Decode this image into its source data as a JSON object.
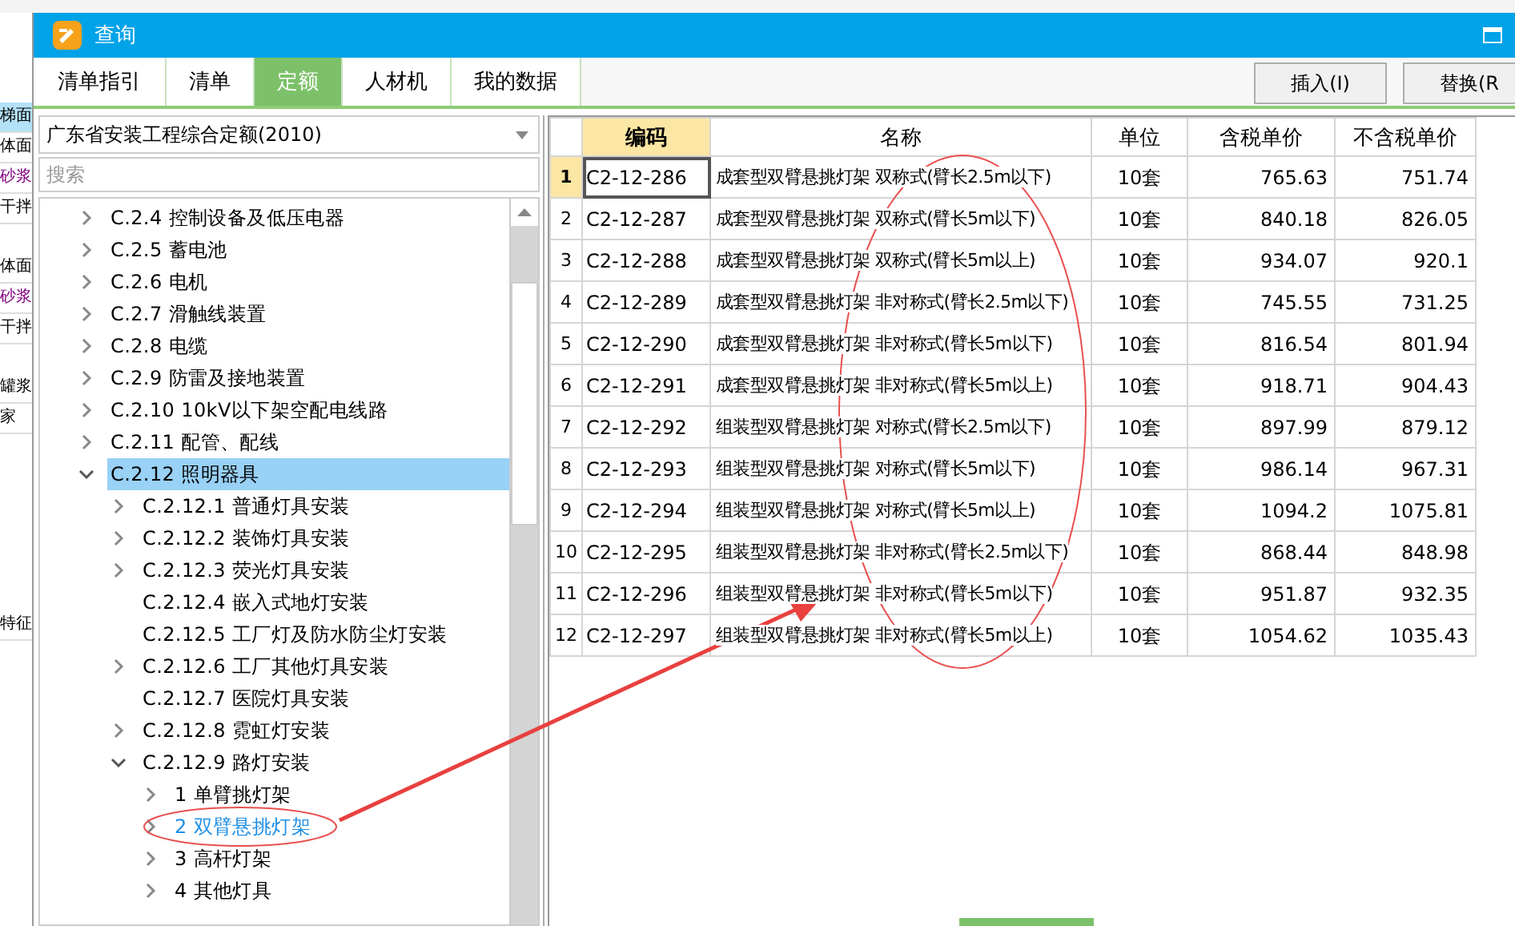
{
  "background_app": {
    "side_labels": [
      {
        "text": "梯面",
        "color": "#000000",
        "selected": true
      },
      {
        "text": "体面",
        "color": "#000000",
        "selected": false
      },
      {
        "text": "砂浆",
        "color": "#800080",
        "selected": false
      },
      {
        "text": "干拌",
        "color": "#000000",
        "selected": false
      },
      {
        "text": "体面",
        "color": "#000000",
        "selected": false
      },
      {
        "text": "砂浆",
        "color": "#800080",
        "selected": false
      },
      {
        "text": "干拌",
        "color": "#000000",
        "selected": false
      },
      {
        "text": "罐浆",
        "color": "#000000",
        "selected": false
      },
      {
        "text": "家",
        "color": "#000000",
        "selected": false
      },
      {
        "text": "特征",
        "color": "#000000",
        "selected": false
      }
    ]
  },
  "window": {
    "title": "查询"
  },
  "tabs": [
    {
      "label": "清单指引",
      "selected": false
    },
    {
      "label": "清单",
      "selected": false
    },
    {
      "label": "定额",
      "selected": true
    },
    {
      "label": "人材机",
      "selected": false
    },
    {
      "label": "我的数据",
      "selected": false
    }
  ],
  "buttons": [
    "插入(I)",
    "替换(R"
  ],
  "library_dropdown": {
    "value": "广东省安装工程综合定额(2010)"
  },
  "search": {
    "placeholder": "搜索"
  },
  "tree": [
    {
      "label": "C.2.4 控制设备及低压电器",
      "kind": "branch",
      "expanded": false,
      "selected": false,
      "focused": false
    },
    {
      "label": "C.2.5 蓄电池",
      "kind": "branch",
      "expanded": false,
      "selected": false,
      "focused": false
    },
    {
      "label": "C.2.6 电机",
      "kind": "branch",
      "expanded": false,
      "selected": false,
      "focused": false
    },
    {
      "label": "C.2.7 滑触线装置",
      "kind": "branch",
      "expanded": false,
      "selected": false,
      "focused": false
    },
    {
      "label": "C.2.8 电缆",
      "kind": "branch",
      "expanded": false,
      "selected": false,
      "focused": false
    },
    {
      "label": "C.2.9 防雷及接地装置",
      "kind": "branch",
      "expanded": false,
      "selected": false,
      "focused": false
    },
    {
      "label": "C.2.10 10kV以下架空配电线路",
      "kind": "branch",
      "expanded": false,
      "selected": false,
      "focused": false
    },
    {
      "label": "C.2.11 配管、配线",
      "kind": "branch",
      "expanded": false,
      "selected": false,
      "focused": false
    },
    {
      "label": "C.2.12 照明器具",
      "kind": "branch",
      "expanded": true,
      "selected": true,
      "focused": false,
      "children": [
        {
          "label": "C.2.12.1 普通灯具安装",
          "kind": "branch",
          "expanded": false,
          "selected": false,
          "focused": false
        },
        {
          "label": "C.2.12.2 装饰灯具安装",
          "kind": "branch",
          "expanded": false,
          "selected": false,
          "focused": false
        },
        {
          "label": "C.2.12.3 荧光灯具安装",
          "kind": "branch",
          "expanded": false,
          "selected": false,
          "focused": false
        },
        {
          "label": "C.2.12.4 嵌入式地灯安装",
          "kind": "leaf",
          "selected": false,
          "focused": false
        },
        {
          "label": "C.2.12.5 工厂灯及防水防尘灯安装",
          "kind": "leaf",
          "selected": false,
          "focused": false
        },
        {
          "label": "C.2.12.6 工厂其他灯具安装",
          "kind": "branch",
          "expanded": false,
          "selected": false,
          "focused": false
        },
        {
          "label": "C.2.12.7 医院灯具安装",
          "kind": "leaf",
          "selected": false,
          "focused": false
        },
        {
          "label": "C.2.12.8 霓虹灯安装",
          "kind": "branch",
          "expanded": false,
          "selected": false,
          "focused": false
        },
        {
          "label": "C.2.12.9 路灯安装",
          "kind": "branch",
          "expanded": true,
          "selected": false,
          "focused": false,
          "children": [
            {
              "label": "1 单臂挑灯架",
              "kind": "branch",
              "expanded": false,
              "selected": false,
              "focused": false
            },
            {
              "label": "2 双臂悬挑灯架",
              "kind": "branch",
              "expanded": false,
              "selected": false,
              "focused": true
            },
            {
              "label": "3 高杆灯架",
              "kind": "branch",
              "expanded": false,
              "selected": false,
              "focused": false
            },
            {
              "label": "4 其他灯具",
              "kind": "branch",
              "expanded": false,
              "selected": false,
              "focused": false
            }
          ]
        }
      ]
    }
  ],
  "table": {
    "columns": [
      "编码",
      "名称",
      "单位",
      "含税单价",
      "不含税单价"
    ],
    "rows": [
      {
        "number": "1",
        "code": "C2-12-286",
        "name": "成套型双臂悬挑灯架 双称式(臂长2.5m以下)",
        "unit": "10套",
        "price_with_tax": "765.63",
        "price_without_tax": "751.74",
        "selected": true
      },
      {
        "number": "2",
        "code": "C2-12-287",
        "name": "成套型双臂悬挑灯架 双称式(臂长5m以下)",
        "unit": "10套",
        "price_with_tax": "840.18",
        "price_without_tax": "826.05",
        "selected": false
      },
      {
        "number": "3",
        "code": "C2-12-288",
        "name": "成套型双臂悬挑灯架 双称式(臂长5m以上)",
        "unit": "10套",
        "price_with_tax": "934.07",
        "price_without_tax": "920.1",
        "selected": false
      },
      {
        "number": "4",
        "code": "C2-12-289",
        "name": "成套型双臂悬挑灯架 非对称式(臂长2.5m以下)",
        "unit": "10套",
        "price_with_tax": "745.55",
        "price_without_tax": "731.25",
        "selected": false
      },
      {
        "number": "5",
        "code": "C2-12-290",
        "name": "成套型双臂悬挑灯架 非对称式(臂长5m以下)",
        "unit": "10套",
        "price_with_tax": "816.54",
        "price_without_tax": "801.94",
        "selected": false
      },
      {
        "number": "6",
        "code": "C2-12-291",
        "name": "成套型双臂悬挑灯架 非对称式(臂长5m以上)",
        "unit": "10套",
        "price_with_tax": "918.71",
        "price_without_tax": "904.43",
        "selected": false
      },
      {
        "number": "7",
        "code": "C2-12-292",
        "name": "组装型双臂悬挑灯架 对称式(臂长2.5m以下)",
        "unit": "10套",
        "price_with_tax": "897.99",
        "price_without_tax": "879.12",
        "selected": false
      },
      {
        "number": "8",
        "code": "C2-12-293",
        "name": "组装型双臂悬挑灯架 对称式(臂长5m以下)",
        "unit": "10套",
        "price_with_tax": "986.14",
        "price_without_tax": "967.31",
        "selected": false
      },
      {
        "number": "9",
        "code": "C2-12-294",
        "name": "组装型双臂悬挑灯架 对称式(臂长5m以上)",
        "unit": "10套",
        "price_with_tax": "1094.2",
        "price_without_tax": "1075.81",
        "selected": false
      },
      {
        "number": "10",
        "code": "C2-12-295",
        "name": "组装型双臂悬挑灯架 非对称式(臂长2.5m以下)",
        "unit": "10套",
        "price_with_tax": "868.44",
        "price_without_tax": "848.98",
        "selected": false
      },
      {
        "number": "11",
        "code": "C2-12-296",
        "name": "组装型双臂悬挑灯架 非对称式(臂长5m以下)",
        "unit": "10套",
        "price_with_tax": "951.87",
        "price_without_tax": "932.35",
        "selected": false
      },
      {
        "number": "12",
        "code": "C2-12-297",
        "name": "组装型双臂悬挑灯架 非对称式(臂长5m以上)",
        "unit": "10套",
        "price_with_tax": "1054.62",
        "price_without_tax": "1035.43",
        "selected": false
      }
    ]
  }
}
